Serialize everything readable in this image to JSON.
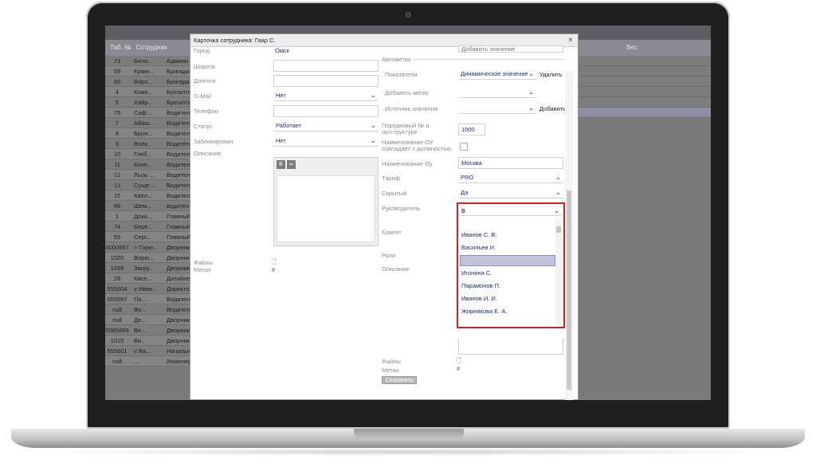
{
  "background_app": {
    "header": {
      "col_tab": "Таб. №",
      "col_employee": "Сотрудник",
      "col_weight": "Вес"
    },
    "rows": [
      {
        "tab": "73",
        "name": "Беля...",
        "role": "Админи"
      },
      {
        "tab": "59",
        "name": "Кукин...",
        "role": "Бригади"
      },
      {
        "tab": "60",
        "name": "Воро...",
        "role": "Бригади"
      },
      {
        "tab": "4",
        "name": "Коже...",
        "role": "Бухгалте"
      },
      {
        "tab": "5",
        "name": "Хайр...",
        "role": "Бухгалте"
      },
      {
        "tab": "79",
        "name": "Саф...",
        "role": "Водител"
      },
      {
        "tab": "7",
        "name": "Абаш...",
        "role": "Водител"
      },
      {
        "tab": "8",
        "name": "Брон...",
        "role": "Водител"
      },
      {
        "tab": "9",
        "name": "Волк...",
        "role": "Водител"
      },
      {
        "tab": "10",
        "name": "Глеб...",
        "role": "Водител"
      },
      {
        "tab": "11",
        "name": "Коно...",
        "role": "Водител"
      },
      {
        "tab": "12",
        "name": "Лызь ...",
        "role": "Водител"
      },
      {
        "tab": "13",
        "name": "Суще...",
        "role": "Водител"
      },
      {
        "tab": "15",
        "name": "Капл...",
        "role": "Водител"
      },
      {
        "tab": "86",
        "name": "Шем...",
        "role": "водител"
      },
      {
        "tab": "1",
        "name": "Доки...",
        "role": "Главный"
      },
      {
        "tab": "74",
        "name": "Бере...",
        "role": "Главный"
      },
      {
        "tab": "55",
        "name": "Серг...",
        "role": "Главный"
      },
      {
        "tab": "0000997",
        "name": "> Горю...",
        "role": "Дворник"
      },
      {
        "tab": "1020",
        "name": "Ворю...",
        "role": "Дворник"
      },
      {
        "tab": "1099",
        "name": "Загру...",
        "role": "Дворник"
      },
      {
        "tab": "28",
        "name": "Кисе...",
        "role": "Дизайне"
      },
      {
        "tab": "555604",
        "name": "v Иван...",
        "role": "Директо"
      },
      {
        "tab": "555597",
        "name": "Па...",
        "role": "Водител"
      },
      {
        "tab": "null",
        "name": "Во...",
        "role": "Водител"
      },
      {
        "tab": "null",
        "name": "Дв...",
        "role": "Дворник"
      },
      {
        "tab": "0085669",
        "name": "Ве...",
        "role": "Дворник"
      },
      {
        "tab": "1010",
        "name": "Ви...",
        "role": "Дворник"
      },
      {
        "tab": "555601",
        "name": "v Ва...",
        "role": "Начальн"
      },
      {
        "tab": "null",
        "name": "...",
        "role": "Инженер"
      }
    ]
  },
  "modal": {
    "title": "Карточка сотрудника: Гаар С.",
    "close": "×",
    "left": {
      "city_label": "Город",
      "city_value": "Омск",
      "lat_label": "Широта",
      "lon_label": "Долгота",
      "gmail_label": "G-Mail",
      "gmail_value": "Нет",
      "phone_label": "Телефон",
      "status_label": "Статус",
      "status_value": "Работает",
      "blocked_label": "Заблокирован",
      "blocked_value": "Нет",
      "desc_label": "Описание",
      "editor_bold": "B",
      "editor_link": "∞",
      "files_label": "Файлы",
      "files_icon": "🗋",
      "tags_label": "Метки",
      "tags_icon": "#"
    },
    "right": {
      "add_value_top": "Добавить значение",
      "automarks_label": "Автометки",
      "indicators_label": "Показатели",
      "indicators_value": "Динамическое значение",
      "remove_btn": "Удалить",
      "add_mark_label": "Добавить метку",
      "value_source_label": "Источник значения",
      "add_btn": "Добавить",
      "order_label": "Порядковый № в оргструктуре",
      "order_value": "1000",
      "ou_match_label": "Наименование ОУ совпадает с должностью",
      "ou_name_label": "Наименование Оу",
      "ou_name_value": "Москва",
      "tariff_label": "Тариф",
      "tariff_value": "PRO",
      "hidden_label": "Скрытый",
      "hidden_value": "Да",
      "manager_label": "Руководитель",
      "manager_input": "В",
      "client_label": "Клиент",
      "roles_label": "Роли",
      "desc_label": "Описание",
      "files_label": "Файлы",
      "files_icon": "🗋",
      "tags_label": "Метки",
      "tags_icon": "#",
      "save_btn": "Сохранить"
    },
    "dropdown_options": [
      "Иванов С. В.",
      "Васильев И.",
      "",
      "Игонина С.",
      "Парамонов П.",
      "Иванов И. И.",
      "Жирнякова Е. А."
    ]
  },
  "colors": {
    "highlight_border": "#d9201f",
    "link_text": "#1d2a7a",
    "selected_option": "#c2c2dc"
  }
}
